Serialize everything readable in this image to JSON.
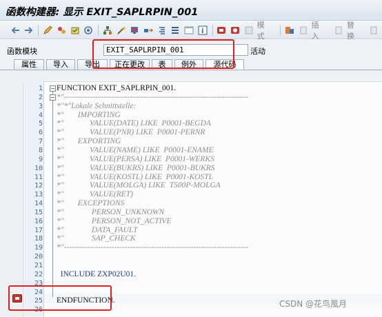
{
  "window": {
    "title": "函数构建器: 显示 EXIT_SAPLRPIN_001"
  },
  "toolbar": {
    "icons": [
      "back-arrow-icon",
      "forward-arrow-icon",
      "toggle-edit-icon",
      "check-icon",
      "activate-icon",
      "where-used-icon",
      "magic-wand-icon",
      "test-icon",
      "move-icon",
      "hierarchy-icon",
      "pretty-print-icon",
      "stack-icon",
      "info-icon",
      "stop-icon",
      "watchpoint-icon"
    ],
    "pattern_label": "模式",
    "insert_label": "插入",
    "replace_label": "替换"
  },
  "function_module": {
    "label": "函数模块",
    "value": "EXIT_SAPLRPIN_001",
    "status": "活动"
  },
  "tabs": [
    {
      "label": "属性"
    },
    {
      "label": "导入"
    },
    {
      "label": "导出"
    },
    {
      "label": "正在更改"
    },
    {
      "label": "表"
    },
    {
      "label": "例外"
    },
    {
      "label": "源代码",
      "active": true
    }
  ],
  "code_lines": [
    {
      "n": "1",
      "text": "FUNCTION EXIT_SAPLRPIN_001.",
      "kind": "kw"
    },
    {
      "n": "2",
      "text": "*\"----------------------------------------------------------------------",
      "kind": "cm"
    },
    {
      "n": "3",
      "text": "*\"*\"Lokale Schnittstelle:",
      "kind": "cm"
    },
    {
      "n": "4",
      "text": "*\"       IMPORTING",
      "kind": "cm"
    },
    {
      "n": "5",
      "text": "*\"             VALUE(DATE) LIKE  P0001-BEGDA",
      "kind": "cm"
    },
    {
      "n": "6",
      "text": "*\"             VALUE(PNR) LIKE  P0001-PERNR",
      "kind": "cm"
    },
    {
      "n": "7",
      "text": "*\"       EXPORTING",
      "kind": "cm"
    },
    {
      "n": "8",
      "text": "*\"             VALUE(NAME) LIKE  P0001-ENAME",
      "kind": "cm"
    },
    {
      "n": "9",
      "text": "*\"             VALUE(PERSA) LIKE  P0001-WERKS",
      "kind": "cm"
    },
    {
      "n": "10",
      "text": "*\"             VALUE(BUKRS) LIKE  P0001-BUKRS",
      "kind": "cm"
    },
    {
      "n": "11",
      "text": "*\"             VALUE(KOSTL) LIKE  P0001-KOSTL",
      "kind": "cm"
    },
    {
      "n": "12",
      "text": "*\"             VALUE(MOLGA) LIKE  T500P-MOLGA",
      "kind": "cm"
    },
    {
      "n": "13",
      "text": "*\"             VALUE(RET)",
      "kind": "cm"
    },
    {
      "n": "14",
      "text": "*\"       EXCEPTIONS",
      "kind": "cm"
    },
    {
      "n": "15",
      "text": "*\"              PERSON_UNKNOWN",
      "kind": "cm"
    },
    {
      "n": "16",
      "text": "*\"              PERSON_NOT_ACTIVE",
      "kind": "cm"
    },
    {
      "n": "17",
      "text": "*\"              DATA_FAULT",
      "kind": "cm"
    },
    {
      "n": "18",
      "text": "*\"              SAP_CHECK",
      "kind": "cm"
    },
    {
      "n": "19",
      "text": "*\"----------------------------------------------------------------------",
      "kind": "cm"
    },
    {
      "n": "20",
      "text": "",
      "kind": "kw"
    },
    {
      "n": "21",
      "text": "",
      "kind": "kw"
    },
    {
      "n": "22",
      "text": "  INCLUDE ZXP02U01.",
      "kind": "inc"
    },
    {
      "n": "23",
      "text": "",
      "kind": "kw"
    },
    {
      "n": "24",
      "text": "",
      "kind": "kw"
    },
    {
      "n": "25",
      "text": "ENDFUNCTION.",
      "kind": "kw"
    },
    {
      "n": "26",
      "text": "",
      "kind": "kw"
    }
  ],
  "watermark": "CSDN @花鸟風月"
}
